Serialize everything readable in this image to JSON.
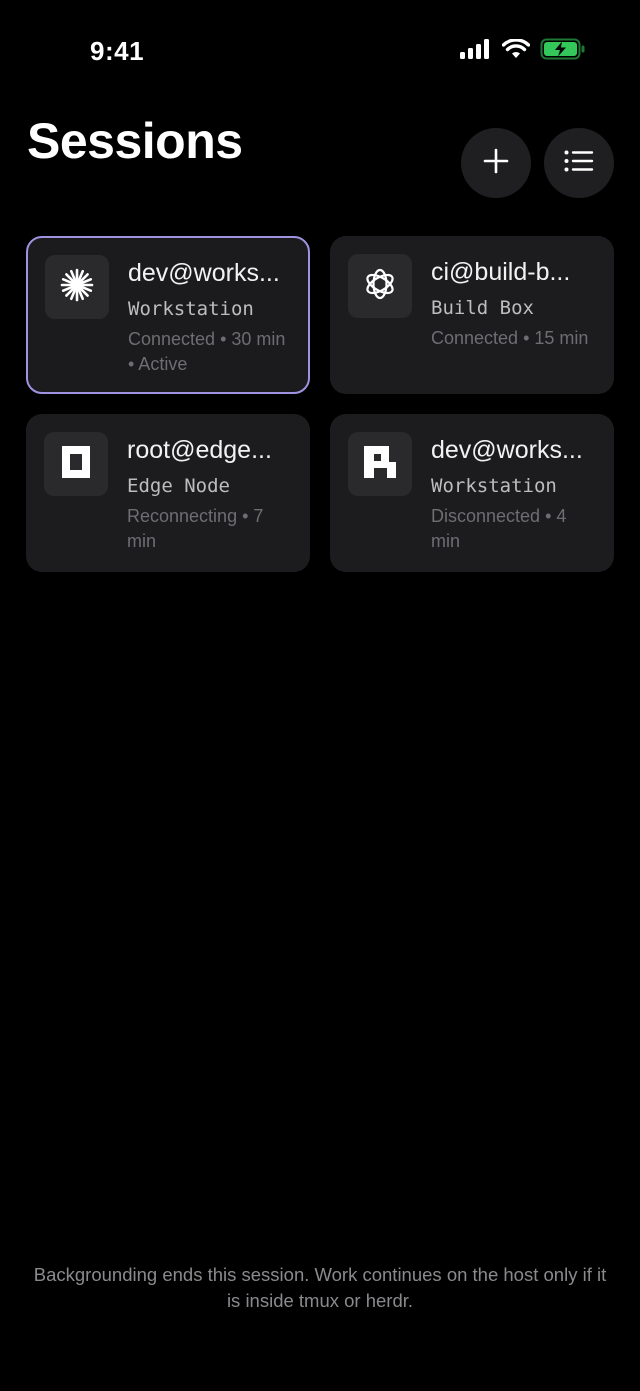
{
  "status_bar": {
    "time": "9:41",
    "battery_color": "#34c759"
  },
  "header": {
    "title": "Sessions",
    "add_icon": "plus-icon",
    "list_icon": "list-icon"
  },
  "sessions": [
    {
      "host": "dev@works...",
      "label": "Workstation",
      "status": "Connected • 30 min • Active",
      "icon": "sparkle-icon",
      "active": true
    },
    {
      "host": "ci@build-b...",
      "label": "Build Box",
      "status": "Connected • 15 min",
      "icon": "openai-knot-icon",
      "active": false
    },
    {
      "host": "root@edge...",
      "label": "Edge Node",
      "status": "Reconnecting • 7 min",
      "icon": "square-frame-icon",
      "active": false
    },
    {
      "host": "dev@works...",
      "label": "Workstation",
      "status": "Disconnected • 4 min",
      "icon": "pixel-block-icon",
      "active": false
    }
  ],
  "footer": {
    "note": "Backgrounding ends this session. Work continues on the host only if it is inside tmux or herdr."
  },
  "colors": {
    "background": "#000000",
    "card": "#1c1c1e",
    "active_border": "#9f92e0"
  }
}
